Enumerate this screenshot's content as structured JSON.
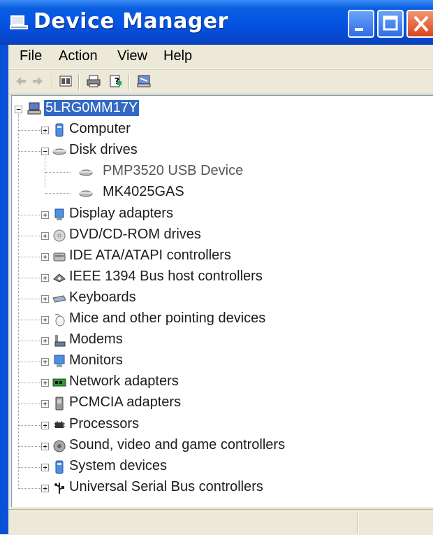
{
  "window": {
    "title": "Device Manager"
  },
  "menu": [
    "File",
    "Action",
    "View",
    "Help"
  ],
  "tree": {
    "root": "5LRG0MM17Y",
    "categories": [
      {
        "label": "Computer",
        "icon": "computer-icon",
        "expanded": false
      },
      {
        "label": "Disk drives",
        "icon": "disk-drive-icon",
        "expanded": true,
        "children": [
          "PMP3520 USB Device",
          "MK4025GAS"
        ]
      },
      {
        "label": "Display adapters",
        "icon": "display-adapter-icon",
        "expanded": false
      },
      {
        "label": "DVD/CD-ROM drives",
        "icon": "dvd-drive-icon",
        "expanded": false
      },
      {
        "label": "IDE ATA/ATAPI controllers",
        "icon": "ide-controller-icon",
        "expanded": false
      },
      {
        "label": "IEEE 1394 Bus host controllers",
        "icon": "ieee1394-icon",
        "expanded": false
      },
      {
        "label": "Keyboards",
        "icon": "keyboard-icon",
        "expanded": false
      },
      {
        "label": "Mice and other pointing devices",
        "icon": "mouse-icon",
        "expanded": false
      },
      {
        "label": "Modems",
        "icon": "modem-icon",
        "expanded": false
      },
      {
        "label": "Monitors",
        "icon": "monitor-icon",
        "expanded": false
      },
      {
        "label": "Network adapters",
        "icon": "network-adapter-icon",
        "expanded": false
      },
      {
        "label": "PCMCIA adapters",
        "icon": "pcmcia-icon",
        "expanded": false
      },
      {
        "label": "Processors",
        "icon": "processor-icon",
        "expanded": false
      },
      {
        "label": "Sound, video and game controllers",
        "icon": "sound-icon",
        "expanded": false
      },
      {
        "label": "System devices",
        "icon": "system-device-icon",
        "expanded": false
      },
      {
        "label": "Universal Serial Bus controllers",
        "icon": "usb-icon",
        "expanded": false
      }
    ]
  },
  "colors": {
    "titlebar": "#0554e3",
    "selection": "#316ac5",
    "window_bg": "#ece9d8"
  }
}
